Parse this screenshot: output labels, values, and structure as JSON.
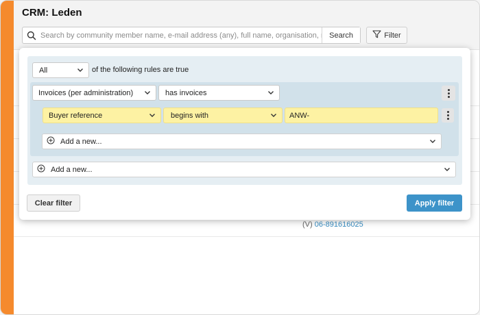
{
  "header": {
    "title": "CRM: Leden",
    "search_placeholder": "Search by community member name, e-mail address (any), full name, organisation, n",
    "search_button": "Search",
    "filter_button": "Filter"
  },
  "background": {
    "phone_prefix": "(V)",
    "phone_number": "06-891616025"
  },
  "filter_panel": {
    "quantifier": "All",
    "quantifier_suffix": "of the following rules are true",
    "rule_group": {
      "field": "Invoices (per administration)",
      "condition": "has invoices",
      "sub_rule": {
        "field": "Buyer reference",
        "operator": "begins with",
        "value": "ANW-"
      },
      "add_new_label": "Add a new..."
    },
    "add_new_label": "Add a new...",
    "clear_button": "Clear filter",
    "apply_button": "Apply filter"
  },
  "colors": {
    "accent_orange": "#f58a2d",
    "primary_button": "#3d93c9",
    "link": "#3a8fc4",
    "highlight_yellow": "#fdf2a3",
    "group_blue": "#d1e1ea"
  }
}
